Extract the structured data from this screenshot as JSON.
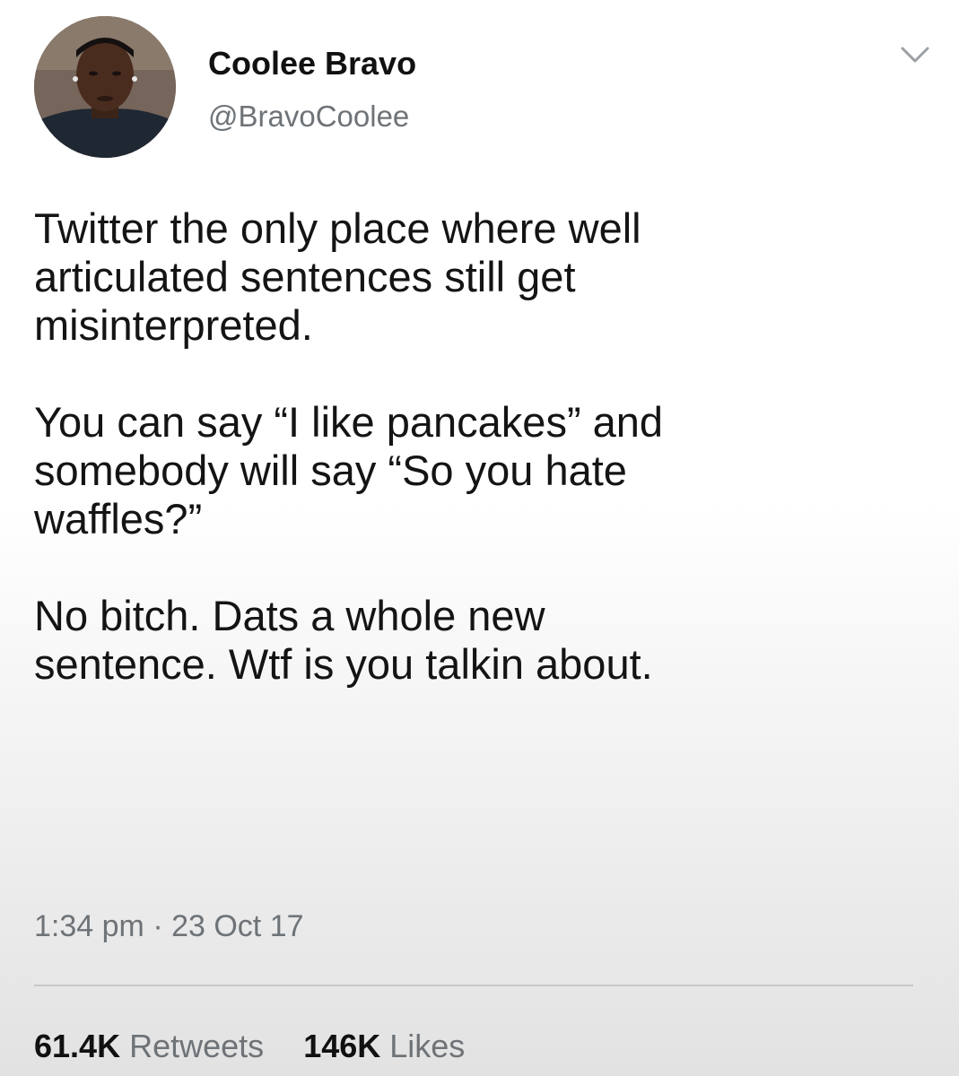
{
  "user": {
    "display_name": "Coolee Bravo",
    "handle": "@BravoCoolee",
    "avatar_icon": "profile-photo"
  },
  "menu": {
    "icon": "chevron-down-icon"
  },
  "tweet": {
    "paragraphs": [
      [
        "Twitter the only place where well",
        "articulated sentences still get",
        "misinterpreted."
      ],
      [
        "You can say “I like pancakes” and",
        "somebody will say “So you hate",
        "waffles?”"
      ],
      [
        "No bitch. Dats a whole new",
        "sentence. Wtf is you talkin about."
      ]
    ],
    "time": "1:34 pm",
    "separator": "·",
    "date": "23 Oct 17"
  },
  "stats": {
    "retweets_count": "61.4K",
    "retweets_label": "Retweets",
    "likes_count": "146K",
    "likes_label": "Likes"
  },
  "colors": {
    "primary_text": "#111111",
    "secondary_text": "#6e7378"
  }
}
